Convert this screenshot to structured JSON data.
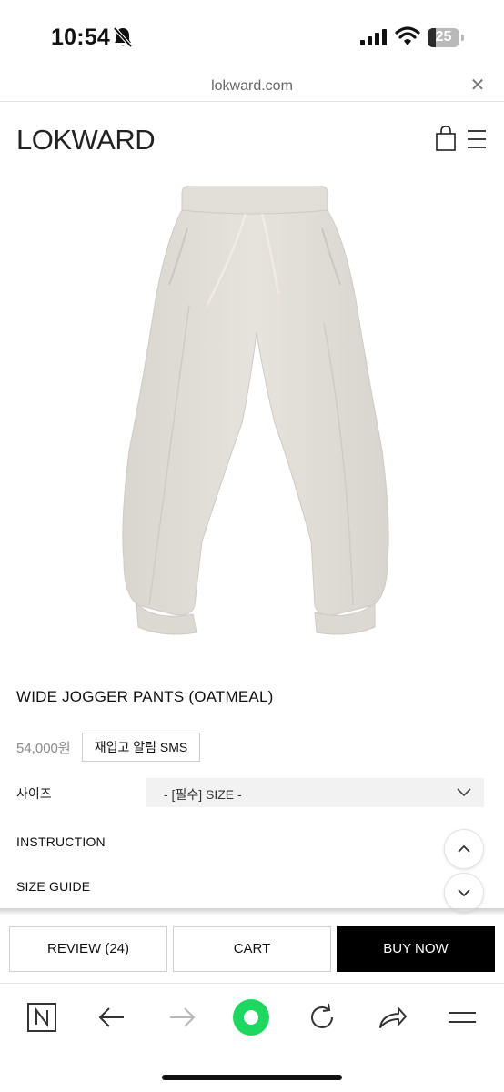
{
  "status_bar": {
    "time": "10:54",
    "battery_percent": "25",
    "battery_level": 0.25,
    "icons": [
      "bell-slash-icon",
      "signal-icon",
      "wifi-icon",
      "battery-icon"
    ]
  },
  "browser": {
    "url": "lokward.com",
    "close_icon": "close-icon"
  },
  "site": {
    "logo": "LOKWARD",
    "icons": [
      "shopping-bag-icon",
      "hamburger-menu-icon"
    ]
  },
  "product": {
    "image": "oatmeal-jogger-pants-photo",
    "name": "WIDE JOGGER PANTS (OATMEAL)",
    "price": "54,000원",
    "restock_label": "재입고 알림 SMS",
    "size_label": "사이즈",
    "size_placeholder": "- [필수] SIZE -",
    "instruction_label": "INSTRUCTION",
    "size_guide_label": "SIZE GUIDE"
  },
  "actions": {
    "review_label": "REVIEW (24)",
    "cart_label": "CART",
    "buy_label": "BUY NOW"
  },
  "toolbar": {
    "icons": [
      "naver-n-icon",
      "back-arrow-icon",
      "forward-arrow-icon",
      "green-dot-icon",
      "refresh-icon",
      "share-icon",
      "menu-lines-icon"
    ]
  },
  "colors": {
    "accent_green": "#1ed760",
    "buy_button": "#000000",
    "pants": "#e4e0da"
  }
}
